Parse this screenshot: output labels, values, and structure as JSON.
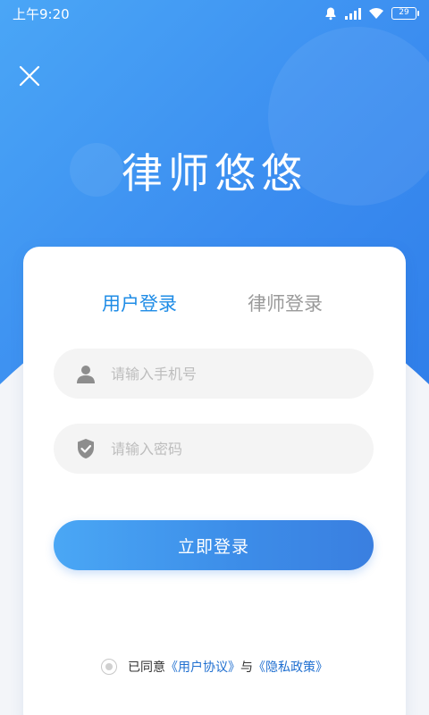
{
  "status_bar": {
    "time": "上午9:20",
    "battery": "29"
  },
  "app_title": "律师悠悠",
  "tabs": [
    {
      "label": "用户登录",
      "active": true
    },
    {
      "label": "律师登录",
      "active": false
    }
  ],
  "form": {
    "phone_placeholder": "请输入手机号",
    "password_placeholder": "请输入密码",
    "submit_label": "立即登录"
  },
  "agreement": {
    "prefix": "已同意",
    "user_agreement": "《用户协议》",
    "joiner": "与",
    "privacy_policy": "《隐私政策》"
  },
  "colors": {
    "accent": "#1f8ce6",
    "hero_gradient_start": "#4aa6f6",
    "hero_gradient_end": "#2f7ee9",
    "inactive_tab": "#9a9a9a",
    "link": "#1f6fd0"
  },
  "icons": {
    "close": "close-icon",
    "phone_field": "user-icon",
    "password_field": "shield-check-icon",
    "status": [
      "bell-icon",
      "signal-icon",
      "wifi-icon",
      "battery-icon"
    ]
  }
}
